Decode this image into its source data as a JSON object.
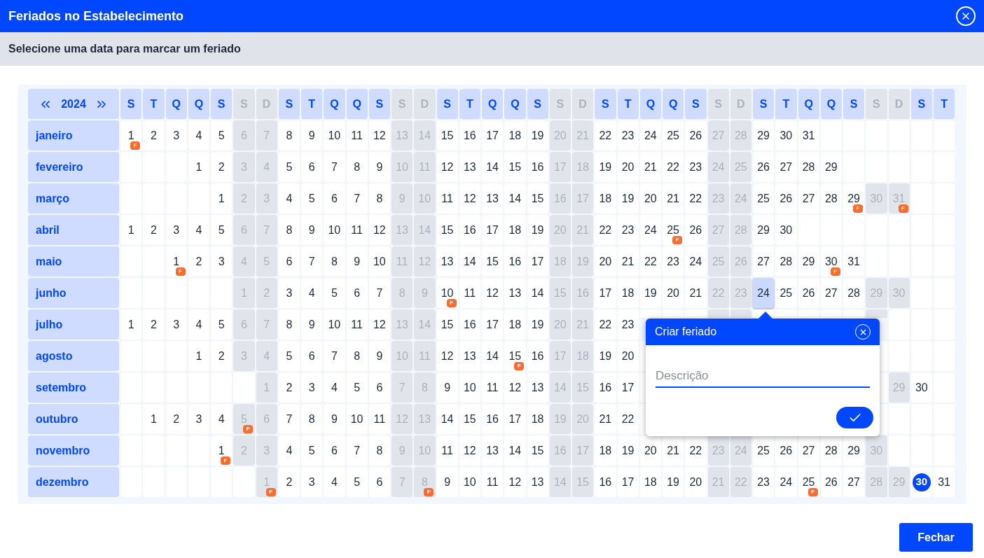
{
  "dialog": {
    "title": "Feriados no Estabelecimento",
    "subtitle": "Selecione uma data para marcar um feriado"
  },
  "calendar": {
    "year": "2024",
    "weekdays": [
      {
        "label": "S",
        "weekend": false
      },
      {
        "label": "T",
        "weekend": false
      },
      {
        "label": "Q",
        "weekend": false
      },
      {
        "label": "Q",
        "weekend": false
      },
      {
        "label": "S",
        "weekend": false
      },
      {
        "label": "S",
        "weekend": true
      },
      {
        "label": "D",
        "weekend": true
      },
      {
        "label": "S",
        "weekend": false
      },
      {
        "label": "T",
        "weekend": false
      },
      {
        "label": "Q",
        "weekend": false
      },
      {
        "label": "Q",
        "weekend": false
      },
      {
        "label": "S",
        "weekend": false
      },
      {
        "label": "S",
        "weekend": true
      },
      {
        "label": "D",
        "weekend": true
      },
      {
        "label": "S",
        "weekend": false
      },
      {
        "label": "T",
        "weekend": false
      },
      {
        "label": "Q",
        "weekend": false
      },
      {
        "label": "Q",
        "weekend": false
      },
      {
        "label": "S",
        "weekend": false
      },
      {
        "label": "S",
        "weekend": true
      },
      {
        "label": "D",
        "weekend": true
      },
      {
        "label": "S",
        "weekend": false
      },
      {
        "label": "T",
        "weekend": false
      },
      {
        "label": "Q",
        "weekend": false
      },
      {
        "label": "Q",
        "weekend": false
      },
      {
        "label": "S",
        "weekend": false
      },
      {
        "label": "S",
        "weekend": true
      },
      {
        "label": "D",
        "weekend": true
      },
      {
        "label": "S",
        "weekend": false
      },
      {
        "label": "T",
        "weekend": false
      },
      {
        "label": "Q",
        "weekend": false
      },
      {
        "label": "Q",
        "weekend": false
      },
      {
        "label": "S",
        "weekend": false
      },
      {
        "label": "S",
        "weekend": true
      },
      {
        "label": "D",
        "weekend": true
      },
      {
        "label": "S",
        "weekend": false
      },
      {
        "label": "T",
        "weekend": false
      }
    ],
    "months": [
      {
        "name": "janeiro",
        "cells": [
          {
            "kind": "day",
            "day": "1",
            "badge": "F"
          },
          {
            "kind": "day",
            "day": "2"
          },
          {
            "kind": "day",
            "day": "3"
          },
          {
            "kind": "day",
            "day": "4"
          },
          {
            "kind": "day",
            "day": "5"
          },
          {
            "kind": "day",
            "day": "6"
          },
          {
            "kind": "day",
            "day": "7"
          },
          {
            "kind": "day",
            "day": "8"
          },
          {
            "kind": "day",
            "day": "9"
          },
          {
            "kind": "day",
            "day": "10"
          },
          {
            "kind": "day",
            "day": "11"
          },
          {
            "kind": "day",
            "day": "12"
          },
          {
            "kind": "day",
            "day": "13"
          },
          {
            "kind": "day",
            "day": "14"
          },
          {
            "kind": "day",
            "day": "15"
          },
          {
            "kind": "day",
            "day": "16"
          },
          {
            "kind": "day",
            "day": "17"
          },
          {
            "kind": "day",
            "day": "18"
          },
          {
            "kind": "day",
            "day": "19"
          },
          {
            "kind": "day",
            "day": "20"
          },
          {
            "kind": "day",
            "day": "21"
          },
          {
            "kind": "day",
            "day": "22"
          },
          {
            "kind": "day",
            "day": "23"
          },
          {
            "kind": "day",
            "day": "24"
          },
          {
            "kind": "day",
            "day": "25"
          },
          {
            "kind": "day",
            "day": "26"
          },
          {
            "kind": "day",
            "day": "27"
          },
          {
            "kind": "day",
            "day": "28"
          },
          {
            "kind": "day",
            "day": "29"
          },
          {
            "kind": "day",
            "day": "30"
          },
          {
            "kind": "day",
            "day": "31"
          },
          {
            "kind": "blank"
          },
          {
            "kind": "blank"
          },
          {
            "kind": "blank"
          },
          {
            "kind": "blank"
          },
          {
            "kind": "blank"
          },
          {
            "kind": "blank"
          }
        ]
      },
      {
        "name": "fevereiro",
        "cells": [
          {
            "kind": "blank"
          },
          {
            "kind": "blank"
          },
          {
            "kind": "blank"
          },
          {
            "kind": "day",
            "day": "1"
          },
          {
            "kind": "day",
            "day": "2"
          },
          {
            "kind": "day",
            "day": "3"
          },
          {
            "kind": "day",
            "day": "4"
          },
          {
            "kind": "day",
            "day": "5"
          },
          {
            "kind": "day",
            "day": "6"
          },
          {
            "kind": "day",
            "day": "7"
          },
          {
            "kind": "day",
            "day": "8"
          },
          {
            "kind": "day",
            "day": "9"
          },
          {
            "kind": "day",
            "day": "10"
          },
          {
            "kind": "day",
            "day": "11"
          },
          {
            "kind": "day",
            "day": "12"
          },
          {
            "kind": "day",
            "day": "13"
          },
          {
            "kind": "day",
            "day": "14"
          },
          {
            "kind": "day",
            "day": "15"
          },
          {
            "kind": "day",
            "day": "16"
          },
          {
            "kind": "day",
            "day": "17"
          },
          {
            "kind": "day",
            "day": "18"
          },
          {
            "kind": "day",
            "day": "19"
          },
          {
            "kind": "day",
            "day": "20"
          },
          {
            "kind": "day",
            "day": "21"
          },
          {
            "kind": "day",
            "day": "22"
          },
          {
            "kind": "day",
            "day": "23"
          },
          {
            "kind": "day",
            "day": "24"
          },
          {
            "kind": "day",
            "day": "25"
          },
          {
            "kind": "day",
            "day": "26"
          },
          {
            "kind": "day",
            "day": "27"
          },
          {
            "kind": "day",
            "day": "28"
          },
          {
            "kind": "day",
            "day": "29"
          },
          {
            "kind": "blank"
          },
          {
            "kind": "blank"
          },
          {
            "kind": "blank"
          },
          {
            "kind": "blank"
          },
          {
            "kind": "blank"
          }
        ]
      },
      {
        "name": "março",
        "cells": [
          {
            "kind": "blank"
          },
          {
            "kind": "blank"
          },
          {
            "kind": "blank"
          },
          {
            "kind": "blank"
          },
          {
            "kind": "day",
            "day": "1"
          },
          {
            "kind": "day",
            "day": "2"
          },
          {
            "kind": "day",
            "day": "3"
          },
          {
            "kind": "day",
            "day": "4"
          },
          {
            "kind": "day",
            "day": "5"
          },
          {
            "kind": "day",
            "day": "6"
          },
          {
            "kind": "day",
            "day": "7"
          },
          {
            "kind": "day",
            "day": "8"
          },
          {
            "kind": "day",
            "day": "9"
          },
          {
            "kind": "day",
            "day": "10"
          },
          {
            "kind": "day",
            "day": "11"
          },
          {
            "kind": "day",
            "day": "12"
          },
          {
            "kind": "day",
            "day": "13"
          },
          {
            "kind": "day",
            "day": "14"
          },
          {
            "kind": "day",
            "day": "15"
          },
          {
            "kind": "day",
            "day": "16"
          },
          {
            "kind": "day",
            "day": "17"
          },
          {
            "kind": "day",
            "day": "18"
          },
          {
            "kind": "day",
            "day": "19"
          },
          {
            "kind": "day",
            "day": "20"
          },
          {
            "kind": "day",
            "day": "21"
          },
          {
            "kind": "day",
            "day": "22"
          },
          {
            "kind": "day",
            "day": "23"
          },
          {
            "kind": "day",
            "day": "24"
          },
          {
            "kind": "day",
            "day": "25"
          },
          {
            "kind": "day",
            "day": "26"
          },
          {
            "kind": "day",
            "day": "27"
          },
          {
            "kind": "day",
            "day": "28"
          },
          {
            "kind": "day",
            "day": "29",
            "badge": "F"
          },
          {
            "kind": "day",
            "day": "30"
          },
          {
            "kind": "day",
            "day": "31",
            "badge": "F"
          },
          {
            "kind": "blank"
          },
          {
            "kind": "blank"
          }
        ]
      },
      {
        "name": "abril",
        "cells": [
          {
            "kind": "day",
            "day": "1"
          },
          {
            "kind": "day",
            "day": "2"
          },
          {
            "kind": "day",
            "day": "3"
          },
          {
            "kind": "day",
            "day": "4"
          },
          {
            "kind": "day",
            "day": "5"
          },
          {
            "kind": "day",
            "day": "6"
          },
          {
            "kind": "day",
            "day": "7"
          },
          {
            "kind": "day",
            "day": "8"
          },
          {
            "kind": "day",
            "day": "9"
          },
          {
            "kind": "day",
            "day": "10"
          },
          {
            "kind": "day",
            "day": "11"
          },
          {
            "kind": "day",
            "day": "12"
          },
          {
            "kind": "day",
            "day": "13"
          },
          {
            "kind": "day",
            "day": "14"
          },
          {
            "kind": "day",
            "day": "15"
          },
          {
            "kind": "day",
            "day": "16"
          },
          {
            "kind": "day",
            "day": "17"
          },
          {
            "kind": "day",
            "day": "18"
          },
          {
            "kind": "day",
            "day": "19"
          },
          {
            "kind": "day",
            "day": "20"
          },
          {
            "kind": "day",
            "day": "21"
          },
          {
            "kind": "day",
            "day": "22"
          },
          {
            "kind": "day",
            "day": "23"
          },
          {
            "kind": "day",
            "day": "24"
          },
          {
            "kind": "day",
            "day": "25",
            "badge": "F"
          },
          {
            "kind": "day",
            "day": "26"
          },
          {
            "kind": "day",
            "day": "27"
          },
          {
            "kind": "day",
            "day": "28"
          },
          {
            "kind": "day",
            "day": "29"
          },
          {
            "kind": "day",
            "day": "30"
          },
          {
            "kind": "blank"
          },
          {
            "kind": "blank"
          },
          {
            "kind": "blank"
          },
          {
            "kind": "blank"
          },
          {
            "kind": "blank"
          },
          {
            "kind": "blank"
          },
          {
            "kind": "blank"
          }
        ]
      },
      {
        "name": "maio",
        "cells": [
          {
            "kind": "blank"
          },
          {
            "kind": "blank"
          },
          {
            "kind": "day",
            "day": "1",
            "badge": "F"
          },
          {
            "kind": "day",
            "day": "2"
          },
          {
            "kind": "day",
            "day": "3"
          },
          {
            "kind": "day",
            "day": "4"
          },
          {
            "kind": "day",
            "day": "5"
          },
          {
            "kind": "day",
            "day": "6"
          },
          {
            "kind": "day",
            "day": "7"
          },
          {
            "kind": "day",
            "day": "8"
          },
          {
            "kind": "day",
            "day": "9"
          },
          {
            "kind": "day",
            "day": "10"
          },
          {
            "kind": "day",
            "day": "11"
          },
          {
            "kind": "day",
            "day": "12"
          },
          {
            "kind": "day",
            "day": "13"
          },
          {
            "kind": "day",
            "day": "14"
          },
          {
            "kind": "day",
            "day": "15"
          },
          {
            "kind": "day",
            "day": "16"
          },
          {
            "kind": "day",
            "day": "17"
          },
          {
            "kind": "day",
            "day": "18"
          },
          {
            "kind": "day",
            "day": "19"
          },
          {
            "kind": "day",
            "day": "20"
          },
          {
            "kind": "day",
            "day": "21"
          },
          {
            "kind": "day",
            "day": "22"
          },
          {
            "kind": "day",
            "day": "23"
          },
          {
            "kind": "day",
            "day": "24"
          },
          {
            "kind": "day",
            "day": "25"
          },
          {
            "kind": "day",
            "day": "26"
          },
          {
            "kind": "day",
            "day": "27"
          },
          {
            "kind": "day",
            "day": "28"
          },
          {
            "kind": "day",
            "day": "29"
          },
          {
            "kind": "day",
            "day": "30",
            "badge": "F"
          },
          {
            "kind": "day",
            "day": "31"
          },
          {
            "kind": "blank"
          },
          {
            "kind": "blank"
          },
          {
            "kind": "blank"
          },
          {
            "kind": "blank"
          }
        ]
      },
      {
        "name": "junho",
        "cells": [
          {
            "kind": "blank"
          },
          {
            "kind": "blank"
          },
          {
            "kind": "blank"
          },
          {
            "kind": "blank"
          },
          {
            "kind": "blank"
          },
          {
            "kind": "day",
            "day": "1"
          },
          {
            "kind": "day",
            "day": "2"
          },
          {
            "kind": "day",
            "day": "3"
          },
          {
            "kind": "day",
            "day": "4"
          },
          {
            "kind": "day",
            "day": "5"
          },
          {
            "kind": "day",
            "day": "6"
          },
          {
            "kind": "day",
            "day": "7"
          },
          {
            "kind": "day",
            "day": "8"
          },
          {
            "kind": "day",
            "day": "9"
          },
          {
            "kind": "day",
            "day": "10",
            "badge": "F"
          },
          {
            "kind": "day",
            "day": "11"
          },
          {
            "kind": "day",
            "day": "12"
          },
          {
            "kind": "day",
            "day": "13"
          },
          {
            "kind": "day",
            "day": "14"
          },
          {
            "kind": "day",
            "day": "15"
          },
          {
            "kind": "day",
            "day": "16"
          },
          {
            "kind": "day",
            "day": "17"
          },
          {
            "kind": "day",
            "day": "18"
          },
          {
            "kind": "day",
            "day": "19"
          },
          {
            "kind": "day",
            "day": "20"
          },
          {
            "kind": "day",
            "day": "21"
          },
          {
            "kind": "day",
            "day": "22"
          },
          {
            "kind": "day",
            "day": "23"
          },
          {
            "kind": "selected",
            "day": "24"
          },
          {
            "kind": "day",
            "day": "25"
          },
          {
            "kind": "day",
            "day": "26"
          },
          {
            "kind": "day",
            "day": "27"
          },
          {
            "kind": "day",
            "day": "28"
          },
          {
            "kind": "day",
            "day": "29"
          },
          {
            "kind": "day",
            "day": "30"
          },
          {
            "kind": "blank"
          },
          {
            "kind": "blank"
          }
        ]
      },
      {
        "name": "julho",
        "cells": [
          {
            "kind": "day",
            "day": "1"
          },
          {
            "kind": "day",
            "day": "2"
          },
          {
            "kind": "day",
            "day": "3"
          },
          {
            "kind": "day",
            "day": "4"
          },
          {
            "kind": "day",
            "day": "5"
          },
          {
            "kind": "day",
            "day": "6"
          },
          {
            "kind": "day",
            "day": "7"
          },
          {
            "kind": "day",
            "day": "8"
          },
          {
            "kind": "day",
            "day": "9"
          },
          {
            "kind": "day",
            "day": "10"
          },
          {
            "kind": "day",
            "day": "11"
          },
          {
            "kind": "day",
            "day": "12"
          },
          {
            "kind": "day",
            "day": "13"
          },
          {
            "kind": "day",
            "day": "14"
          },
          {
            "kind": "day",
            "day": "15"
          },
          {
            "kind": "day",
            "day": "16"
          },
          {
            "kind": "day",
            "day": "17"
          },
          {
            "kind": "day",
            "day": "18"
          },
          {
            "kind": "day",
            "day": "19"
          },
          {
            "kind": "day",
            "day": "20"
          },
          {
            "kind": "day",
            "day": "21"
          },
          {
            "kind": "day",
            "day": "22"
          },
          {
            "kind": "day",
            "day": "23"
          },
          {
            "kind": "covered"
          },
          {
            "kind": "covered"
          },
          {
            "kind": "covered"
          },
          {
            "kind": "covered"
          },
          {
            "kind": "covered"
          },
          {
            "kind": "covered"
          },
          {
            "kind": "covered"
          },
          {
            "kind": "covered"
          },
          {
            "kind": "covered"
          },
          {
            "kind": "covered"
          },
          {
            "kind": "covered"
          },
          {
            "kind": "blank"
          },
          {
            "kind": "blank"
          },
          {
            "kind": "blank"
          }
        ]
      },
      {
        "name": "agosto",
        "cells": [
          {
            "kind": "blank"
          },
          {
            "kind": "blank"
          },
          {
            "kind": "blank"
          },
          {
            "kind": "day",
            "day": "1"
          },
          {
            "kind": "day",
            "day": "2"
          },
          {
            "kind": "day",
            "day": "3"
          },
          {
            "kind": "day",
            "day": "4"
          },
          {
            "kind": "day",
            "day": "5"
          },
          {
            "kind": "day",
            "day": "6"
          },
          {
            "kind": "day",
            "day": "7"
          },
          {
            "kind": "day",
            "day": "8"
          },
          {
            "kind": "day",
            "day": "9"
          },
          {
            "kind": "day",
            "day": "10"
          },
          {
            "kind": "day",
            "day": "11"
          },
          {
            "kind": "day",
            "day": "12"
          },
          {
            "kind": "day",
            "day": "13"
          },
          {
            "kind": "day",
            "day": "14"
          },
          {
            "kind": "day",
            "day": "15",
            "badge": "F"
          },
          {
            "kind": "day",
            "day": "16"
          },
          {
            "kind": "day",
            "day": "17"
          },
          {
            "kind": "day",
            "day": "18"
          },
          {
            "kind": "day",
            "day": "19"
          },
          {
            "kind": "day",
            "day": "20"
          },
          {
            "kind": "blank"
          },
          {
            "kind": "hidden"
          },
          {
            "kind": "hidden"
          },
          {
            "kind": "hidden"
          },
          {
            "kind": "hidden"
          },
          {
            "kind": "blank"
          },
          {
            "kind": "blank"
          },
          {
            "kind": "blank"
          },
          {
            "kind": "blank"
          },
          {
            "kind": "blank"
          },
          {
            "kind": "blank"
          },
          {
            "kind": "blank"
          },
          {
            "kind": "blank"
          },
          {
            "kind": "blank"
          }
        ]
      },
      {
        "name": "setembro",
        "cells": [
          {
            "kind": "blank"
          },
          {
            "kind": "blank"
          },
          {
            "kind": "blank"
          },
          {
            "kind": "blank"
          },
          {
            "kind": "blank"
          },
          {
            "kind": "blank"
          },
          {
            "kind": "day",
            "day": "1"
          },
          {
            "kind": "day",
            "day": "2"
          },
          {
            "kind": "day",
            "day": "3"
          },
          {
            "kind": "day",
            "day": "4"
          },
          {
            "kind": "day",
            "day": "5"
          },
          {
            "kind": "day",
            "day": "6"
          },
          {
            "kind": "day",
            "day": "7"
          },
          {
            "kind": "day",
            "day": "8"
          },
          {
            "kind": "day",
            "day": "9"
          },
          {
            "kind": "day",
            "day": "10"
          },
          {
            "kind": "day",
            "day": "11"
          },
          {
            "kind": "day",
            "day": "12"
          },
          {
            "kind": "day",
            "day": "13"
          },
          {
            "kind": "day",
            "day": "14"
          },
          {
            "kind": "day",
            "day": "15"
          },
          {
            "kind": "day",
            "day": "16"
          },
          {
            "kind": "day",
            "day": "17"
          },
          {
            "kind": "blank"
          },
          {
            "kind": "blank"
          },
          {
            "kind": "blank"
          },
          {
            "kind": "blank"
          },
          {
            "kind": "blank"
          },
          {
            "kind": "blank"
          },
          {
            "kind": "blank"
          },
          {
            "kind": "blank"
          },
          {
            "kind": "blank"
          },
          {
            "kind": "blank"
          },
          {
            "kind": "blank"
          },
          {
            "kind": "day",
            "day": "29"
          },
          {
            "kind": "day",
            "day": "30"
          },
          {
            "kind": "blank"
          }
        ]
      },
      {
        "name": "outubro",
        "cells": [
          {
            "kind": "blank"
          },
          {
            "kind": "day",
            "day": "1"
          },
          {
            "kind": "day",
            "day": "2"
          },
          {
            "kind": "day",
            "day": "3"
          },
          {
            "kind": "day",
            "day": "4"
          },
          {
            "kind": "day",
            "day": "5",
            "badge": "F"
          },
          {
            "kind": "day",
            "day": "6"
          },
          {
            "kind": "day",
            "day": "7"
          },
          {
            "kind": "day",
            "day": "8"
          },
          {
            "kind": "day",
            "day": "9"
          },
          {
            "kind": "day",
            "day": "10"
          },
          {
            "kind": "day",
            "day": "11"
          },
          {
            "kind": "day",
            "day": "12"
          },
          {
            "kind": "day",
            "day": "13"
          },
          {
            "kind": "day",
            "day": "14"
          },
          {
            "kind": "day",
            "day": "15"
          },
          {
            "kind": "day",
            "day": "16"
          },
          {
            "kind": "day",
            "day": "17"
          },
          {
            "kind": "day",
            "day": "18"
          },
          {
            "kind": "day",
            "day": "19"
          },
          {
            "kind": "day",
            "day": "20"
          },
          {
            "kind": "day",
            "day": "21"
          },
          {
            "kind": "day",
            "day": "22"
          },
          {
            "kind": "blank"
          },
          {
            "kind": "blank"
          },
          {
            "kind": "blank"
          },
          {
            "kind": "blank"
          },
          {
            "kind": "blank"
          },
          {
            "kind": "blank"
          },
          {
            "kind": "blank"
          },
          {
            "kind": "blank"
          },
          {
            "kind": "blank"
          },
          {
            "kind": "blank"
          },
          {
            "kind": "blank"
          },
          {
            "kind": "blank"
          },
          {
            "kind": "blank"
          },
          {
            "kind": "blank"
          }
        ]
      },
      {
        "name": "novembro",
        "cells": [
          {
            "kind": "blank"
          },
          {
            "kind": "blank"
          },
          {
            "kind": "blank"
          },
          {
            "kind": "blank"
          },
          {
            "kind": "day",
            "day": "1",
            "badge": "F"
          },
          {
            "kind": "day",
            "day": "2"
          },
          {
            "kind": "day",
            "day": "3"
          },
          {
            "kind": "day",
            "day": "4"
          },
          {
            "kind": "day",
            "day": "5"
          },
          {
            "kind": "day",
            "day": "6"
          },
          {
            "kind": "day",
            "day": "7"
          },
          {
            "kind": "day",
            "day": "8"
          },
          {
            "kind": "day",
            "day": "9"
          },
          {
            "kind": "day",
            "day": "10"
          },
          {
            "kind": "day",
            "day": "11"
          },
          {
            "kind": "day",
            "day": "12"
          },
          {
            "kind": "day",
            "day": "13"
          },
          {
            "kind": "day",
            "day": "14"
          },
          {
            "kind": "day",
            "day": "15"
          },
          {
            "kind": "day",
            "day": "16"
          },
          {
            "kind": "day",
            "day": "17"
          },
          {
            "kind": "day",
            "day": "18"
          },
          {
            "kind": "day",
            "day": "19"
          },
          {
            "kind": "day",
            "day": "20"
          },
          {
            "kind": "day",
            "day": "21"
          },
          {
            "kind": "day",
            "day": "22"
          },
          {
            "kind": "day",
            "day": "23"
          },
          {
            "kind": "day",
            "day": "24"
          },
          {
            "kind": "day",
            "day": "25"
          },
          {
            "kind": "day",
            "day": "26"
          },
          {
            "kind": "day",
            "day": "27"
          },
          {
            "kind": "day",
            "day": "28"
          },
          {
            "kind": "day",
            "day": "29"
          },
          {
            "kind": "day",
            "day": "30"
          },
          {
            "kind": "blank"
          },
          {
            "kind": "blank"
          },
          {
            "kind": "blank"
          }
        ]
      },
      {
        "name": "dezembro",
        "cells": [
          {
            "kind": "blank"
          },
          {
            "kind": "blank"
          },
          {
            "kind": "blank"
          },
          {
            "kind": "blank"
          },
          {
            "kind": "blank"
          },
          {
            "kind": "blank"
          },
          {
            "kind": "day",
            "day": "1",
            "badge": "F"
          },
          {
            "kind": "day",
            "day": "2"
          },
          {
            "kind": "day",
            "day": "3"
          },
          {
            "kind": "day",
            "day": "4"
          },
          {
            "kind": "day",
            "day": "5"
          },
          {
            "kind": "day",
            "day": "6"
          },
          {
            "kind": "day",
            "day": "7"
          },
          {
            "kind": "day",
            "day": "8",
            "badge": "F"
          },
          {
            "kind": "day",
            "day": "9"
          },
          {
            "kind": "day",
            "day": "10"
          },
          {
            "kind": "day",
            "day": "11"
          },
          {
            "kind": "day",
            "day": "12"
          },
          {
            "kind": "day",
            "day": "13"
          },
          {
            "kind": "day",
            "day": "14"
          },
          {
            "kind": "day",
            "day": "15"
          },
          {
            "kind": "day",
            "day": "16"
          },
          {
            "kind": "day",
            "day": "17"
          },
          {
            "kind": "day",
            "day": "18"
          },
          {
            "kind": "day",
            "day": "19"
          },
          {
            "kind": "day",
            "day": "20"
          },
          {
            "kind": "day",
            "day": "21"
          },
          {
            "kind": "day",
            "day": "22"
          },
          {
            "kind": "day",
            "day": "23"
          },
          {
            "kind": "day",
            "day": "24"
          },
          {
            "kind": "day",
            "day": "25",
            "badge": "F"
          },
          {
            "kind": "day",
            "day": "26"
          },
          {
            "kind": "day",
            "day": "27"
          },
          {
            "kind": "day",
            "day": "28"
          },
          {
            "kind": "day",
            "day": "29"
          },
          {
            "kind": "today",
            "day": "30"
          },
          {
            "kind": "day",
            "day": "31"
          }
        ]
      }
    ]
  },
  "popover": {
    "title": "Criar feriado",
    "field": {
      "placeholder": "Descrição"
    }
  },
  "buttons": [
    {
      "label": "Fechar"
    }
  ]
}
